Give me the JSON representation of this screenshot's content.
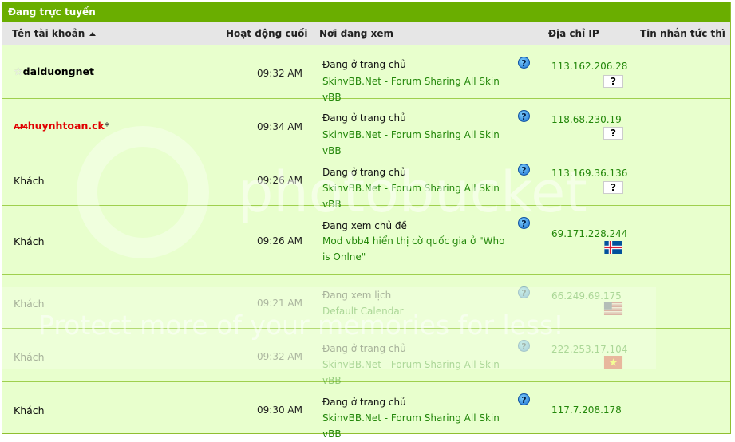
{
  "panel_title": "Đang trực tuyến",
  "columns": {
    "account": "Tên tài khoản",
    "activity": "Hoạt động cuối",
    "location": "Nơi đang xem",
    "ip": "Địa chỉ IP",
    "pm": "Tin nhắn tức thì"
  },
  "rows": [
    {
      "user": "daiduongnet",
      "tag": "",
      "suffix": "",
      "time": "09:32 AM",
      "status": "Đang ở trang chủ",
      "link": "SkinvBB.Net - Forum Sharing All Skin vBB",
      "ip": "113.162.206.28",
      "flag": "unknown"
    },
    {
      "user": "huynhtoan.ck",
      "tag": "AM",
      "suffix": "*",
      "time": "09:34 AM",
      "status": "Đang ở trang chủ",
      "link": "SkinvBB.Net - Forum Sharing All Skin vBB",
      "ip": "118.68.230.19",
      "flag": "unknown"
    },
    {
      "user": "Khách",
      "tag": "",
      "suffix": "",
      "time": "09:26 AM",
      "status": "Đang ở trang chủ",
      "link": "SkinvBB.Net - Forum Sharing All Skin vBB",
      "ip": "113.169.36.136",
      "flag": "unknown"
    },
    {
      "user": "Khách",
      "tag": "",
      "suffix": "",
      "time": "09:26 AM",
      "status": "Đang xem chủ đề",
      "link": "Mod vbb4 hiển thị cờ quốc gia ở \"Who is Onlne\"",
      "ip": "69.171.228.244",
      "flag": "iceland"
    },
    {
      "user": "Khách",
      "tag": "",
      "suffix": "",
      "time": "09:21 AM",
      "status": "Đang xem lịch",
      "link": "Default Calendar",
      "ip": "66.249.69.175",
      "flag": "usa"
    },
    {
      "user": "Khách",
      "tag": "",
      "suffix": "",
      "time": "09:32 AM",
      "status": "Đang ở trang chủ",
      "link": "SkinvBB.Net - Forum Sharing All Skin vBB",
      "ip": "222.253.17.104",
      "flag": "vietnam"
    },
    {
      "user": "Khách",
      "tag": "",
      "suffix": "",
      "time": "09:30 AM",
      "status": "Đang ở trang chủ",
      "link": "SkinvBB.Net - Forum Sharing All Skin vBB",
      "ip": "117.7.208.178",
      "flag": "none"
    }
  ],
  "help_icon_glyph": "?",
  "unknown_flag_glyph": "?",
  "star_glyph": "☆",
  "watermark": {
    "logo": "photobucket",
    "text": "Protect more of your memories for less!"
  },
  "colors": {
    "header_green": "#6aae00",
    "row_bg": "#e8ffcd",
    "link_green": "#23870a",
    "border_green": "#9fd04e"
  }
}
